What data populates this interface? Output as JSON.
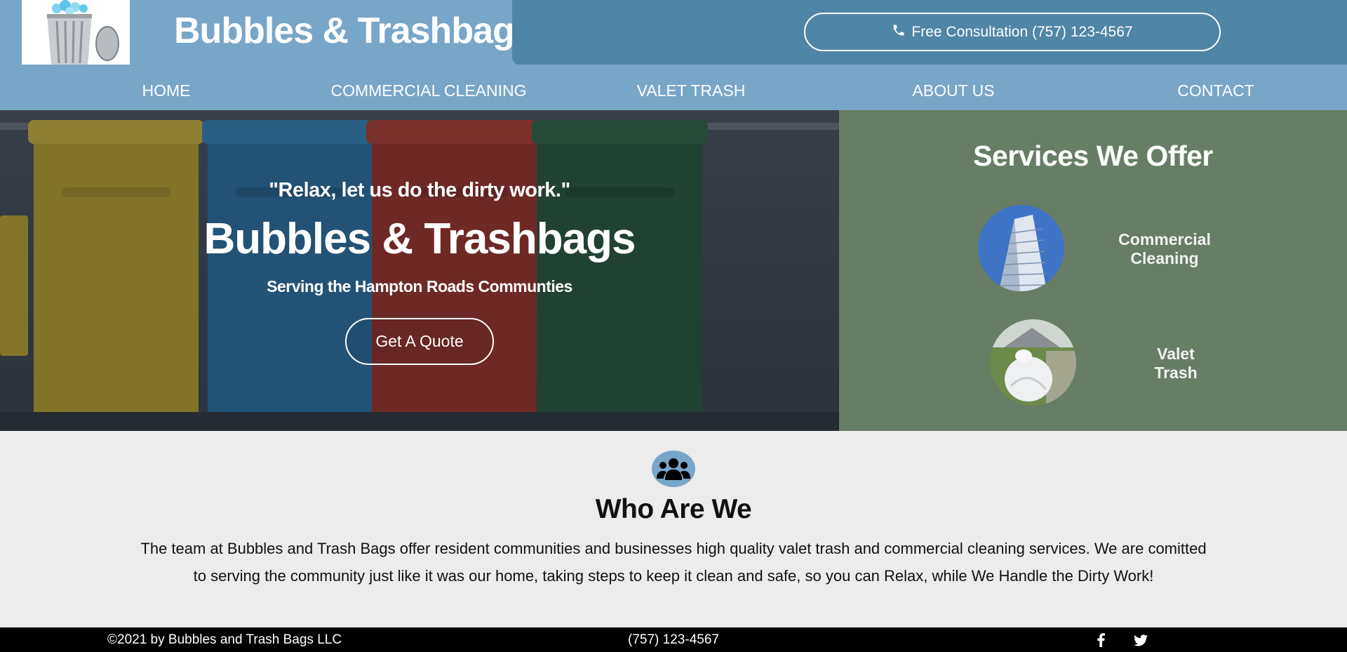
{
  "header": {
    "brand": "Bubbles & Trashbags",
    "consult_label": "Free Consultation (757) 123-4567",
    "nav": [
      "HOME",
      "COMMERCIAL CLEANING",
      "VALET TRASH",
      "ABOUT US",
      "CONTACT"
    ]
  },
  "hero": {
    "quote": "\"Relax, let us do the dirty work.\"",
    "title": "Bubbles & Trashbags",
    "subtitle": "Serving the Hampton Roads Communties",
    "button": "Get A Quote"
  },
  "services": {
    "title": "Services We Offer",
    "items": [
      {
        "label_line1": "Commercial",
        "label_line2": "Cleaning"
      },
      {
        "label_line1": "Valet",
        "label_line2": "Trash"
      }
    ]
  },
  "who": {
    "title": "Who Are We",
    "text": "The team at Bubbles and Trash Bags offer resident communities and businesses high quality valet trash and commercial cleaning services. We are comitted to serving the community just like it was our home, taking steps to keep it clean and safe, so you can Relax, while We Handle the Dirty Work!"
  },
  "footer": {
    "copyright": "©2021 by Bubbles and Trash Bags LLC",
    "phone": "(757) 123-4567"
  },
  "icons": {
    "phone": "phone-icon",
    "group": "users-icon",
    "facebook": "facebook-icon",
    "twitter": "twitter-icon"
  },
  "colors": {
    "header_bg": "#77a6c9",
    "cta_panel": "#4f86a8",
    "services_bg": "#677d66",
    "footer_bg": "#000000"
  }
}
